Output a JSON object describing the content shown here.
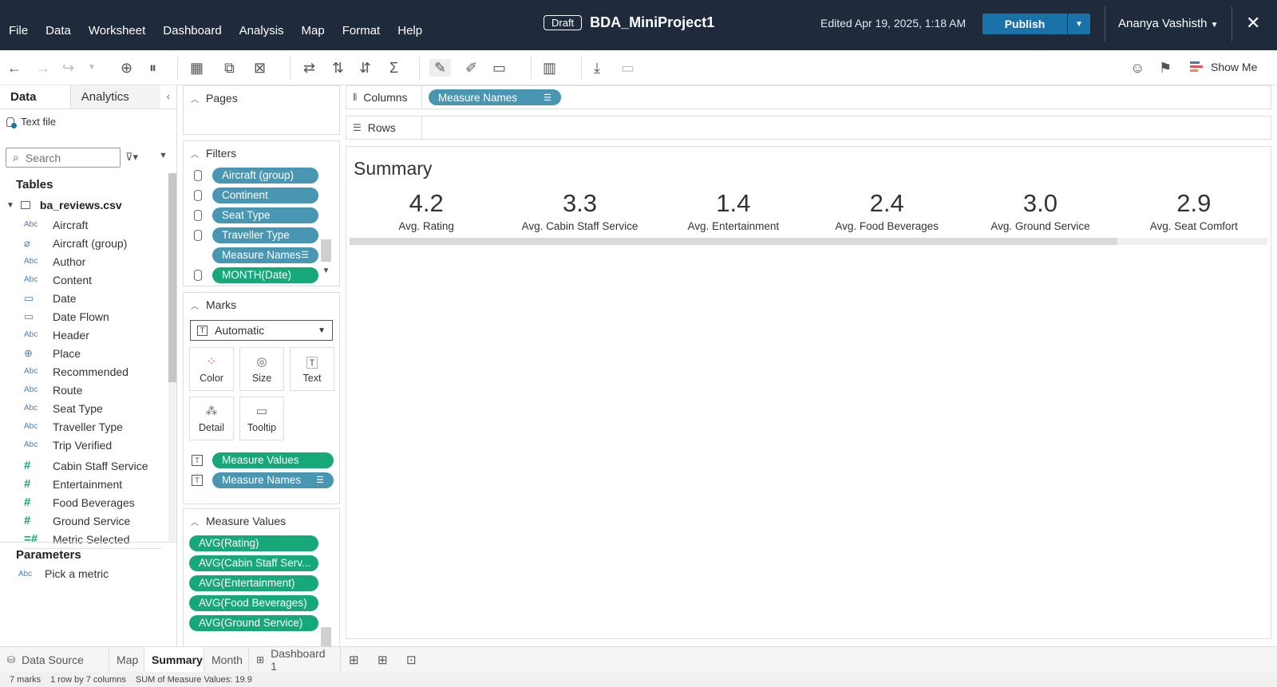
{
  "menu": [
    "File",
    "Data",
    "Worksheet",
    "Dashboard",
    "Analysis",
    "Map",
    "Format",
    "Help"
  ],
  "header": {
    "draft_label": "Draft",
    "workbook_title": "BDA_MiniProject1",
    "edited": "Edited Apr 19, 2025, 1:18 AM",
    "publish": "Publish",
    "user": "Ananya Vashisth"
  },
  "toolbar": {
    "show_me": "Show Me"
  },
  "data_pane": {
    "tabs": [
      "Data",
      "Analytics"
    ],
    "source": "Text file",
    "search_placeholder": "Search",
    "tables_heading": "Tables",
    "table_name": "ba_reviews.csv",
    "fields": [
      {
        "type": "Abc",
        "name": "Aircraft",
        "kind": "dim"
      },
      {
        "type": "group",
        "name": "Aircraft (group)",
        "kind": "dim"
      },
      {
        "type": "Abc",
        "name": "Author",
        "kind": "dim"
      },
      {
        "type": "Abc",
        "name": "Content",
        "kind": "dim"
      },
      {
        "type": "date",
        "name": "Date",
        "kind": "dim"
      },
      {
        "type": "date",
        "name": "Date Flown",
        "kind": "dim"
      },
      {
        "type": "Abc",
        "name": "Header",
        "kind": "dim"
      },
      {
        "type": "geo",
        "name": "Place",
        "kind": "dim"
      },
      {
        "type": "Abc",
        "name": "Recommended",
        "kind": "dim"
      },
      {
        "type": "Abc",
        "name": "Route",
        "kind": "dim"
      },
      {
        "type": "Abc",
        "name": "Seat Type",
        "kind": "dim"
      },
      {
        "type": "Abc",
        "name": "Traveller Type",
        "kind": "dim"
      },
      {
        "type": "Abc",
        "name": "Trip Verified",
        "kind": "dim"
      },
      {
        "type": "#",
        "name": "Cabin Staff Service",
        "kind": "meas"
      },
      {
        "type": "#",
        "name": "Entertainment",
        "kind": "meas"
      },
      {
        "type": "#",
        "name": "Food Beverages",
        "kind": "meas"
      },
      {
        "type": "#",
        "name": "Ground Service",
        "kind": "meas"
      },
      {
        "type": "=#",
        "name": "Metric Selected",
        "kind": "meas"
      }
    ],
    "parameters_heading": "Parameters",
    "parameters": [
      {
        "type": "Abc",
        "name": "Pick a metric"
      }
    ]
  },
  "cards": {
    "pages": "Pages",
    "filters": "Filters",
    "filter_items": [
      {
        "label": "Aircraft (group)",
        "color": "blue"
      },
      {
        "label": "Continent",
        "color": "blue"
      },
      {
        "label": "Seat Type",
        "color": "blue"
      },
      {
        "label": "Traveller Type",
        "color": "blue"
      },
      {
        "label": "Measure Names",
        "color": "blue"
      },
      {
        "label": "MONTH(Date)",
        "color": "green"
      }
    ],
    "marks": "Marks",
    "mark_type": "Automatic",
    "mark_buttons": [
      "Color",
      "Size",
      "Text",
      "Detail",
      "Tooltip"
    ],
    "mark_fields": [
      {
        "label": "Measure Values",
        "color": "green"
      },
      {
        "label": "Measure Names",
        "color": "blue"
      }
    ],
    "measure_values": "Measure Values",
    "measure_value_items": [
      "AVG(Rating)",
      "AVG(Cabin Staff Serv...",
      "AVG(Entertainment)",
      "AVG(Food Beverages)",
      "AVG(Ground Service)"
    ]
  },
  "shelves": {
    "columns": "Columns",
    "columns_pill": "Measure Names",
    "rows": "Rows"
  },
  "viz": {
    "title": "Summary",
    "kpis": [
      {
        "value": "4.2",
        "label": "Avg. Rating"
      },
      {
        "value": "3.3",
        "label": "Avg. Cabin Staff Service"
      },
      {
        "value": "1.4",
        "label": "Avg. Entertainment"
      },
      {
        "value": "2.4",
        "label": "Avg. Food Beverages"
      },
      {
        "value": "3.0",
        "label": "Avg. Ground Service"
      },
      {
        "value": "2.9",
        "label": "Avg. Seat Comfort"
      }
    ]
  },
  "sheet_tabs": [
    "Data Source",
    "Map",
    "Summary",
    "Month",
    "Dashboard 1"
  ],
  "active_tab": "Summary",
  "status": {
    "marks": "7 marks",
    "rows_cols": "1 row by 7 columns",
    "sum": "SUM of Measure Values: 19.9"
  },
  "colors": {
    "topbar": "#1f2a3c",
    "publish": "#1a73a8",
    "dimension_pill": "#4996b2",
    "measure_pill": "#16a879"
  }
}
